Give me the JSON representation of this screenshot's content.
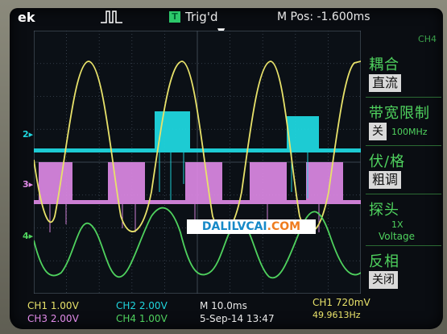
{
  "top": {
    "brand": "ek",
    "trigger_state": "Trig'd",
    "trigger_badge": "T",
    "m_pos": "M Pos: -1.600ms"
  },
  "menu": {
    "header": "CH4",
    "coupling_title": "耦合",
    "coupling_value": "直流",
    "bw_title": "带宽限制",
    "bw_value": "关",
    "bw_freq": "100MHz",
    "volts_title": "伏/格",
    "volts_value": "粗调",
    "probe_title": "探头",
    "probe_value": "1X",
    "probe_unit": "Voltage",
    "invert_title": "反相",
    "invert_value": "关闭"
  },
  "channel_markers": {
    "ch2": "2",
    "ch3": "3",
    "ch4": "4"
  },
  "bottom": {
    "ch1": "CH1  1.00V",
    "ch2": "CH2 2.00V",
    "ch3": "CH3 2.00V",
    "ch4": "CH4  1.00V",
    "timebase": "M 10.0ms",
    "date": "5-Sep-14 13:47",
    "trigger": "CH1  720mV",
    "freq": "49.9613Hz"
  },
  "watermark": {
    "part1": "DALILVCAI",
    "part2": ".COM"
  },
  "colors": {
    "ch1": "#e8e26a",
    "ch2": "#1fd6de",
    "ch3": "#e08ae8",
    "ch4": "#4fd25e",
    "grid": "#3f4a57"
  }
}
